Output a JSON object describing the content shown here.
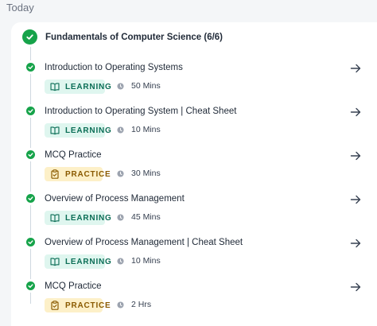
{
  "day_label": "Today",
  "module": {
    "title": "Fundamentals of Computer Science (6/6)",
    "status": "completed"
  },
  "colors": {
    "complete_green": "#16a34a",
    "learning_bg": "#dff6ef",
    "learning_text": "#0b6e56",
    "practice_bg": "#fdf0c8",
    "practice_text": "#8a5a00"
  },
  "items": [
    {
      "title": "Introduction to Operating Systems",
      "tag": "LEARNING",
      "tag_icon": "book-icon",
      "duration": "50 Mins"
    },
    {
      "title": "Introduction to Operating System | Cheat Sheet",
      "tag": "LEARNING",
      "tag_icon": "book-icon",
      "duration": "10 Mins"
    },
    {
      "title": "MCQ Practice",
      "tag": "PRACTICE",
      "tag_icon": "clipboard-icon",
      "duration": "30 Mins"
    },
    {
      "title": "Overview of Process Management",
      "tag": "LEARNING",
      "tag_icon": "book-icon",
      "duration": "45 Mins"
    },
    {
      "title": "Overview of Process Management | Cheat Sheet",
      "tag": "LEARNING",
      "tag_icon": "book-icon",
      "duration": "10 Mins"
    },
    {
      "title": "MCQ Practice",
      "tag": "PRACTICE",
      "tag_icon": "clipboard-icon",
      "duration": "2 Hrs"
    }
  ]
}
